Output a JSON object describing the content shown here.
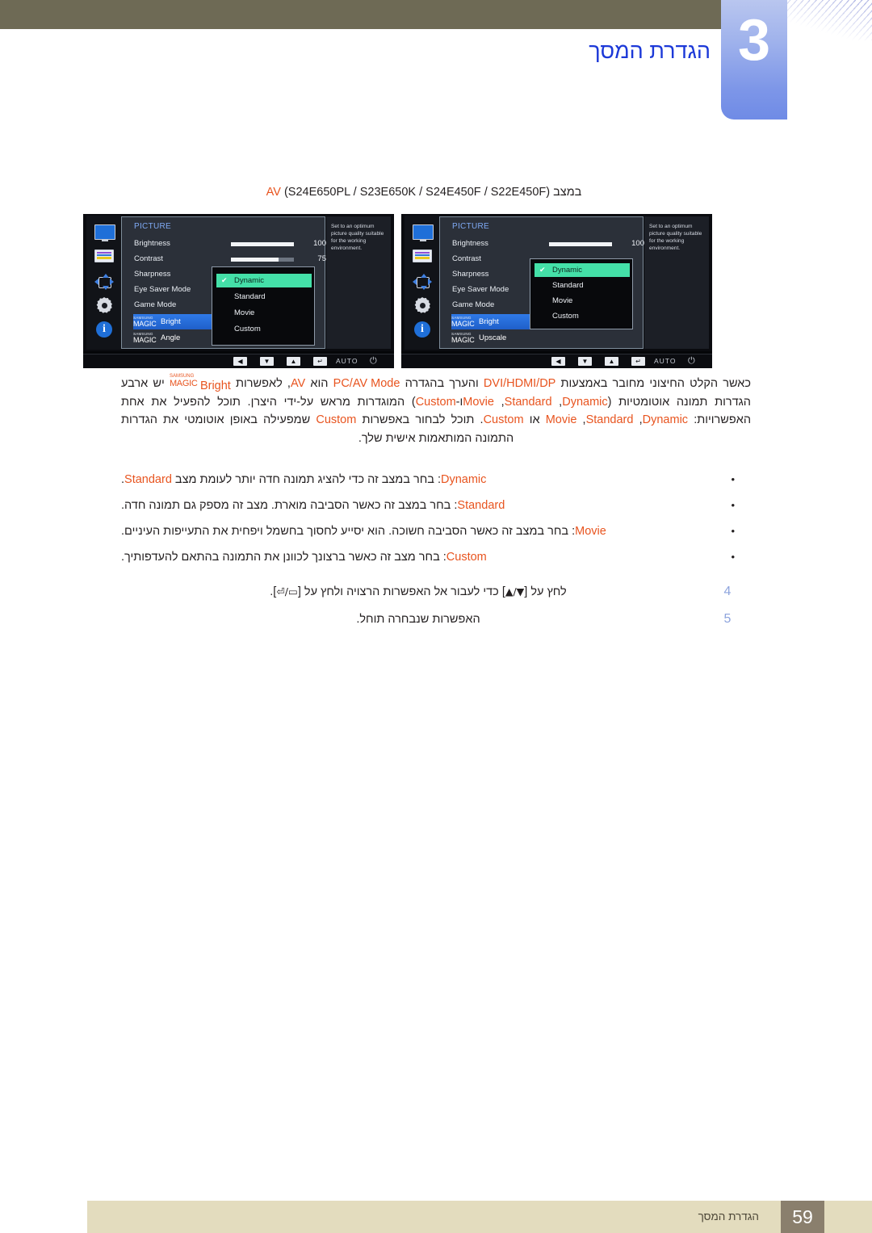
{
  "header": {
    "chapter_number": "3",
    "chapter_title": "הגדרת המסך"
  },
  "caption": {
    "prefix": "במצב ",
    "highlight": "AV",
    "models": " (S24E650PL / S23E650K / S24E450F / S22E450F)"
  },
  "osd": {
    "left": {
      "title": "PICTURE",
      "rows": {
        "brightness": "Brightness",
        "contrast": "Contrast",
        "sharpness": "Sharpness",
        "eye_saver": "Eye Saver Mode",
        "game_mode": "Game Mode"
      },
      "magic_brand_top": "SAMSUNG",
      "magic_brand_bottom": "MAGIC",
      "magic_bright_suffix": "Bright",
      "magic_second_suffix": "Angle",
      "brightness_value": "100",
      "contrast_value": "75",
      "brightness_fill_pct": 100,
      "contrast_fill_pct": 75,
      "help_text": "Set to an optimum picture quality suitable for the working environment.",
      "dropdown": {
        "items": [
          "Dynamic",
          "Standard",
          "Movie",
          "Custom"
        ],
        "selected": "Dynamic",
        "check_glyph": "✔"
      }
    },
    "right": {
      "title": "PICTURE",
      "rows": {
        "brightness": "Brightness",
        "contrast": "Contrast",
        "sharpness": "Sharpness",
        "eye_saver": "Eye Saver Mode",
        "game_mode": "Game Mode"
      },
      "magic_brand_top": "SAMSUNG",
      "magic_brand_bottom": "MAGIC",
      "magic_bright_suffix": "Bright",
      "magic_second_suffix": "Upscale",
      "brightness_value": "100",
      "brightness_fill_pct": 100,
      "help_text": "Set to an optimum picture quality suitable for the working environment.",
      "dropdown": {
        "items": [
          "Dynamic",
          "Standard",
          "Movie",
          "Custom"
        ],
        "selected": "Dynamic",
        "check_glyph": "✔"
      }
    },
    "controlbar": {
      "left_arrow": "◀",
      "down_arrow": "▼",
      "up_arrow": "▲",
      "enter": "↵",
      "auto": "AUTO",
      "power": "⏻"
    },
    "icons": [
      "monitor-icon",
      "color-bars-icon",
      "position-arrows-icon",
      "gear-icon",
      "info-icon"
    ]
  },
  "paragraph": {
    "line1_a": "כאשר הקלט החיצוני מחובר באמצעות ",
    "line1_dvi": "DVI/HDMI/DP",
    "line1_b": " והערך בהגדרה ",
    "line1_pcav": "PC/AV Mode",
    "line1_c": " הוא ",
    "line1_av": "AV",
    "line1_d": ", לאפשרות ",
    "magic_brand_top": "SAMSUNG",
    "magic_brand_bottom": "MAGIC",
    "magic_suffix": "Bright",
    "line2_a": " יש ארבע הגדרות תמונה אוטומטיות (",
    "opt_dynamic": "Dynamic",
    "opt_standard": "Standard",
    "opt_movie": "Movie",
    "opt_custom": "Custom",
    "line2_b": ") המוגדרות מראש על-ידי היצרן. תוכל להפעיל את אחת האפשרויות: ",
    "line3_b": " או ",
    "line3_c": ". תוכל לבחור באפשרות ",
    "line4_a": " שמפעילה באופן אוטומטי את הגדרות התמונה המותאמות אישית שלך."
  },
  "bullets": [
    {
      "term": "Dynamic",
      "text_before": ": בחר במצב זה כדי להציג תמונה חדה יותר לעומת מצב ",
      "ref": "Standard",
      "text_after": "."
    },
    {
      "term": "Standard",
      "text_before": ": בחר במצב זה כאשר הסביבה מוארת. מצב זה מספק גם תמונה חדה.",
      "ref": "",
      "text_after": ""
    },
    {
      "term": "Movie",
      "text_before": ": בחר במצב זה כאשר הסביבה חשוכה. הוא יסייע לחסוך בחשמל ויפחית את התעייפות העיניים.",
      "ref": "",
      "text_after": ""
    },
    {
      "term": "Custom",
      "text_before": ": בחר מצב זה כאשר ברצונך לכוונן את התמונה בהתאם להעדפותיך.",
      "ref": "",
      "text_after": ""
    }
  ],
  "steps": [
    {
      "number": "4",
      "text_a": "לחץ על [",
      "keys_a": "▲/▼",
      "text_b": "] כדי לעבור אל האפשרות הרצויה ולחץ על [",
      "keys_b": "⏎/▭",
      "text_c": "]."
    },
    {
      "number": "5",
      "text_a": "האפשרות שנבחרה תוחל.",
      "keys_a": "",
      "text_b": "",
      "keys_b": "",
      "text_c": ""
    }
  ],
  "footer": {
    "title": "הגדרת המסך",
    "page": "59"
  },
  "colors": {
    "accent_orange": "#e8541f",
    "chapter_blue": "#1c39d8",
    "olive": "#6e6a55",
    "footer_beige": "#e3dcbe",
    "footer_brown": "#8a7f6d",
    "osd_highlight_green": "#44e0a8",
    "osd_blue": "#2f7ae8"
  }
}
